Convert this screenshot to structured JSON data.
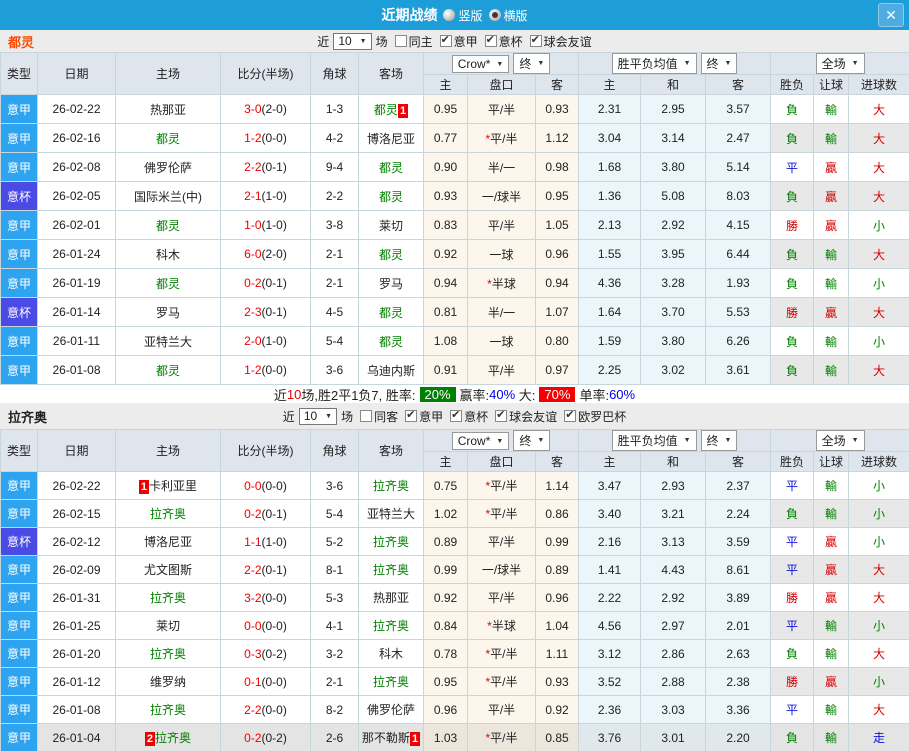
{
  "window": {
    "title": "近期战绩",
    "vertical_label": "竖版",
    "horizontal_label": "横版",
    "close_glyph": "✕"
  },
  "columns": {
    "type": "类型",
    "date": "日期",
    "home": "主场",
    "score": "比分(半场)",
    "corner": "角球",
    "away": "客场",
    "odds_dd": "Crow*",
    "odds_final_dd": "终",
    "avg_dd": "胜平负均值",
    "avg_final_dd": "终",
    "full_dd": "全场",
    "odds_sub": [
      "主",
      "盘口",
      "客"
    ],
    "avg_sub": [
      "主",
      "和",
      "客"
    ],
    "full_sub": [
      "胜负",
      "让球",
      "进球数"
    ]
  },
  "type_colors": {
    "意甲": "#2EA4F0",
    "意杯": "#4A4AE4"
  },
  "result_colors": {
    "勝": "#D40000",
    "負": "#008000",
    "平": "#1010D6",
    "贏": "#D40000",
    "輸": "#008000",
    "大": "#D40000",
    "小": "#008000",
    "走": "#1010D6"
  },
  "sections": [
    {
      "team": "都灵",
      "team_color": "#FF4A00",
      "filter": {
        "near": "近",
        "count": "10",
        "games": "场",
        "checkboxes": [
          {
            "label": "同主",
            "checked": false
          },
          {
            "label": "意甲",
            "checked": true
          },
          {
            "label": "意杯",
            "checked": true
          },
          {
            "label": "球会友谊",
            "checked": true
          }
        ]
      },
      "rows": [
        {
          "type": "意甲",
          "date": "26-02-22",
          "home": {
            "name": "热那亚"
          },
          "score": "3-0",
          "half": "(2-0)",
          "corner": "1-3",
          "away": {
            "name": "都灵",
            "green": true,
            "badge": "1",
            "badge_pos": "after"
          },
          "odds": [
            "0.95",
            "平/半",
            "0.93"
          ],
          "avg": [
            "2.31",
            "2.95",
            "3.57"
          ],
          "results": [
            "負",
            "輸",
            "大"
          ]
        },
        {
          "type": "意甲",
          "date": "26-02-16",
          "home": {
            "name": "都灵",
            "green": true
          },
          "score": "1-2",
          "half": "(0-0)",
          "corner": "4-2",
          "away": {
            "name": "博洛尼亚"
          },
          "odds": [
            "0.77",
            "*平/半",
            "1.12"
          ],
          "avg": [
            "3.04",
            "3.14",
            "2.47"
          ],
          "results": [
            "負",
            "輸",
            "大"
          ]
        },
        {
          "type": "意甲",
          "date": "26-02-08",
          "home": {
            "name": "佛罗伦萨"
          },
          "score": "2-2",
          "half": "(0-1)",
          "corner": "9-4",
          "away": {
            "name": "都灵",
            "green": true
          },
          "odds": [
            "0.90",
            "半/一",
            "0.98"
          ],
          "avg": [
            "1.68",
            "3.80",
            "5.14"
          ],
          "results": [
            "平",
            "贏",
            "大"
          ]
        },
        {
          "type": "意杯",
          "date": "26-02-05",
          "home": {
            "name": "国际米兰(中)"
          },
          "score": "2-1",
          "half": "(1-0)",
          "corner": "2-2",
          "away": {
            "name": "都灵",
            "green": true
          },
          "odds": [
            "0.93",
            "一/球半",
            "0.95"
          ],
          "avg": [
            "1.36",
            "5.08",
            "8.03"
          ],
          "results": [
            "負",
            "贏",
            "大"
          ]
        },
        {
          "type": "意甲",
          "date": "26-02-01",
          "home": {
            "name": "都灵",
            "green": true
          },
          "score": "1-0",
          "half": "(1-0)",
          "corner": "3-8",
          "away": {
            "name": "莱切"
          },
          "odds": [
            "0.83",
            "平/半",
            "1.05"
          ],
          "avg": [
            "2.13",
            "2.92",
            "4.15"
          ],
          "results": [
            "勝",
            "贏",
            "小"
          ]
        },
        {
          "type": "意甲",
          "date": "26-01-24",
          "home": {
            "name": "科木"
          },
          "score": "6-0",
          "half": "(2-0)",
          "corner": "2-1",
          "away": {
            "name": "都灵",
            "green": true
          },
          "odds": [
            "0.92",
            "一球",
            "0.96"
          ],
          "avg": [
            "1.55",
            "3.95",
            "6.44"
          ],
          "results": [
            "負",
            "輸",
            "大"
          ]
        },
        {
          "type": "意甲",
          "date": "26-01-19",
          "home": {
            "name": "都灵",
            "green": true
          },
          "score": "0-2",
          "half": "(0-1)",
          "corner": "2-1",
          "away": {
            "name": "罗马"
          },
          "odds": [
            "0.94",
            "*半球",
            "0.94"
          ],
          "avg": [
            "4.36",
            "3.28",
            "1.93"
          ],
          "results": [
            "負",
            "輸",
            "小"
          ]
        },
        {
          "type": "意杯",
          "date": "26-01-14",
          "home": {
            "name": "罗马"
          },
          "score": "2-3",
          "half": "(0-1)",
          "corner": "4-5",
          "away": {
            "name": "都灵",
            "green": true
          },
          "odds": [
            "0.81",
            "半/一",
            "1.07"
          ],
          "avg": [
            "1.64",
            "3.70",
            "5.53"
          ],
          "results": [
            "勝",
            "贏",
            "大"
          ]
        },
        {
          "type": "意甲",
          "date": "26-01-11",
          "home": {
            "name": "亚特兰大"
          },
          "score": "2-0",
          "half": "(1-0)",
          "corner": "5-4",
          "away": {
            "name": "都灵",
            "green": true
          },
          "odds": [
            "1.08",
            "一球",
            "0.80"
          ],
          "avg": [
            "1.59",
            "3.80",
            "6.26"
          ],
          "results": [
            "負",
            "輸",
            "小"
          ]
        },
        {
          "type": "意甲",
          "date": "26-01-08",
          "home": {
            "name": "都灵",
            "green": true
          },
          "score": "1-2",
          "half": "(0-0)",
          "corner": "3-6",
          "away": {
            "name": "乌迪内斯"
          },
          "odds": [
            "0.91",
            "平/半",
            "0.97"
          ],
          "avg": [
            "2.25",
            "3.02",
            "3.61"
          ],
          "results": [
            "負",
            "輸",
            "大"
          ]
        }
      ],
      "summary": [
        {
          "t": "近",
          "s": "plain"
        },
        {
          "t": "10",
          "s": "red"
        },
        {
          "t": "场,胜2平1负7, 胜率:",
          "s": "plain"
        },
        {
          "t": "20%",
          "s": "green-badge"
        },
        {
          "t": "赢率:",
          "s": "plain"
        },
        {
          "t": "40%",
          "s": "blue"
        },
        {
          "t": " 大:",
          "s": "plain"
        },
        {
          "t": "70%",
          "s": "red-badge"
        },
        {
          "t": "单率:",
          "s": "plain"
        },
        {
          "t": "60%",
          "s": "blue"
        }
      ]
    },
    {
      "team": "拉齐奥",
      "team_color": "#222222",
      "filter": {
        "near": "近",
        "count": "10",
        "games": "场",
        "checkboxes": [
          {
            "label": "同客",
            "checked": false
          },
          {
            "label": "意甲",
            "checked": true
          },
          {
            "label": "意杯",
            "checked": true
          },
          {
            "label": "球会友谊",
            "checked": true
          },
          {
            "label": "欧罗巴杯",
            "checked": true
          }
        ]
      },
      "rows": [
        {
          "type": "意甲",
          "date": "26-02-22",
          "home": {
            "name": "卡利亚里",
            "badge": "1",
            "badge_pos": "before"
          },
          "score": "0-0",
          "half": "(0-0)",
          "corner": "3-6",
          "away": {
            "name": "拉齐奥",
            "green": true
          },
          "odds": [
            "0.75",
            "*平/半",
            "1.14"
          ],
          "avg": [
            "3.47",
            "2.93",
            "2.37"
          ],
          "results": [
            "平",
            "輸",
            "小"
          ]
        },
        {
          "type": "意甲",
          "date": "26-02-15",
          "home": {
            "name": "拉齐奥",
            "green": true
          },
          "score": "0-2",
          "half": "(0-1)",
          "corner": "5-4",
          "away": {
            "name": "亚特兰大"
          },
          "odds": [
            "1.02",
            "*平/半",
            "0.86"
          ],
          "avg": [
            "3.40",
            "3.21",
            "2.24"
          ],
          "results": [
            "負",
            "輸",
            "小"
          ]
        },
        {
          "type": "意杯",
          "date": "26-02-12",
          "home": {
            "name": "博洛尼亚"
          },
          "score": "1-1",
          "half": "(1-0)",
          "corner": "5-2",
          "away": {
            "name": "拉齐奥",
            "green": true
          },
          "odds": [
            "0.89",
            "平/半",
            "0.99"
          ],
          "avg": [
            "2.16",
            "3.13",
            "3.59"
          ],
          "results": [
            "平",
            "贏",
            "小"
          ]
        },
        {
          "type": "意甲",
          "date": "26-02-09",
          "home": {
            "name": "尤文图斯"
          },
          "score": "2-2",
          "half": "(0-1)",
          "corner": "8-1",
          "away": {
            "name": "拉齐奥",
            "green": true
          },
          "odds": [
            "0.99",
            "一/球半",
            "0.89"
          ],
          "avg": [
            "1.41",
            "4.43",
            "8.61"
          ],
          "results": [
            "平",
            "贏",
            "大"
          ]
        },
        {
          "type": "意甲",
          "date": "26-01-31",
          "home": {
            "name": "拉齐奥",
            "green": true
          },
          "score": "3-2",
          "half": "(0-0)",
          "corner": "5-3",
          "away": {
            "name": "热那亚"
          },
          "odds": [
            "0.92",
            "平/半",
            "0.96"
          ],
          "avg": [
            "2.22",
            "2.92",
            "3.89"
          ],
          "results": [
            "勝",
            "贏",
            "大"
          ]
        },
        {
          "type": "意甲",
          "date": "26-01-25",
          "home": {
            "name": "莱切"
          },
          "score": "0-0",
          "half": "(0-0)",
          "corner": "4-1",
          "away": {
            "name": "拉齐奥",
            "green": true
          },
          "odds": [
            "0.84",
            "*半球",
            "1.04"
          ],
          "avg": [
            "4.56",
            "2.97",
            "2.01"
          ],
          "results": [
            "平",
            "輸",
            "小"
          ]
        },
        {
          "type": "意甲",
          "date": "26-01-20",
          "home": {
            "name": "拉齐奥",
            "green": true
          },
          "score": "0-3",
          "half": "(0-2)",
          "corner": "3-2",
          "away": {
            "name": "科木"
          },
          "odds": [
            "0.78",
            "*平/半",
            "1.11"
          ],
          "avg": [
            "3.12",
            "2.86",
            "2.63"
          ],
          "results": [
            "負",
            "輸",
            "大"
          ]
        },
        {
          "type": "意甲",
          "date": "26-01-12",
          "home": {
            "name": "维罗纳"
          },
          "score": "0-1",
          "half": "(0-0)",
          "corner": "2-1",
          "away": {
            "name": "拉齐奥",
            "green": true
          },
          "odds": [
            "0.95",
            "*平/半",
            "0.93"
          ],
          "avg": [
            "3.52",
            "2.88",
            "2.38"
          ],
          "results": [
            "勝",
            "贏",
            "小"
          ]
        },
        {
          "type": "意甲",
          "date": "26-01-08",
          "home": {
            "name": "拉齐奥",
            "green": true
          },
          "score": "2-2",
          "half": "(0-0)",
          "corner": "8-2",
          "away": {
            "name": "佛罗伦萨"
          },
          "odds": [
            "0.96",
            "平/半",
            "0.92"
          ],
          "avg": [
            "2.36",
            "3.03",
            "3.36"
          ],
          "results": [
            "平",
            "輸",
            "大"
          ]
        },
        {
          "type": "意甲",
          "date": "26-01-04",
          "home": {
            "name": "拉齐奥",
            "green": true,
            "badge": "2",
            "badge_pos": "before"
          },
          "score": "0-2",
          "half": "(0-2)",
          "corner": "2-6",
          "away": {
            "name": "那不勒斯",
            "badge": "1",
            "badge_pos": "after"
          },
          "odds": [
            "1.03",
            "*平/半",
            "0.85"
          ],
          "avg": [
            "3.76",
            "3.01",
            "2.20"
          ],
          "results": [
            "負",
            "輸",
            "走"
          ],
          "hover": true
        }
      ]
    }
  ]
}
